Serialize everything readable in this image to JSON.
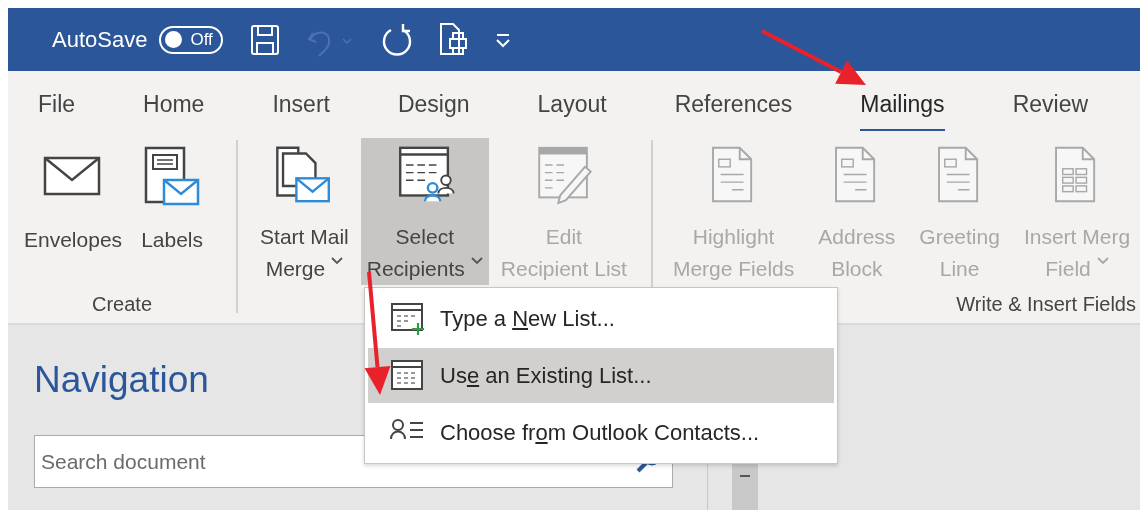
{
  "quick_access": {
    "autosave_label": "AutoSave",
    "autosave_toggle": {
      "on": false,
      "label": "Off"
    },
    "buttons": [
      {
        "kind": "save",
        "disabled": false
      },
      {
        "kind": "undo",
        "disabled": true
      },
      {
        "kind": "repeat",
        "disabled": false
      },
      {
        "kind": "print-preview",
        "disabled": false
      },
      {
        "kind": "customize",
        "disabled": false
      }
    ]
  },
  "tabs": [
    {
      "label": "File",
      "selected": false
    },
    {
      "label": "Home",
      "selected": false
    },
    {
      "label": "Insert",
      "selected": false
    },
    {
      "label": "Design",
      "selected": false
    },
    {
      "label": "Layout",
      "selected": false
    },
    {
      "label": "References",
      "selected": false
    },
    {
      "label": "Mailings",
      "selected": true
    },
    {
      "label": "Review",
      "selected": false
    }
  ],
  "ribbon_groups": [
    {
      "label": "Create",
      "buttons": [
        {
          "kind": "envelope",
          "lines": [
            "Envelopes"
          ],
          "dropdown": false,
          "disabled": false,
          "pressed": false
        },
        {
          "kind": "labels",
          "lines": [
            "Labels"
          ],
          "dropdown": false,
          "disabled": false,
          "pressed": false
        }
      ]
    },
    {
      "buttons": [
        {
          "kind": "start-merge",
          "lines": [
            "Start Mail",
            "Merge"
          ],
          "dropdown": true,
          "disabled": false,
          "pressed": false
        },
        {
          "kind": "select-recipients",
          "lines": [
            "Select",
            "Recipients"
          ],
          "dropdown": true,
          "disabled": false,
          "pressed": true
        },
        {
          "kind": "edit-list",
          "lines": [
            "Edit",
            "Recipient List"
          ],
          "dropdown": false,
          "disabled": true,
          "pressed": false
        }
      ]
    },
    {
      "label": "Write & Insert Fields",
      "buttons": [
        {
          "kind": "field-doc",
          "lines": [
            "Highlight",
            "Merge Fields"
          ],
          "dropdown": false,
          "disabled": true,
          "pressed": false
        },
        {
          "kind": "field-doc",
          "lines": [
            "Address",
            "Block"
          ],
          "dropdown": false,
          "disabled": true,
          "pressed": false
        },
        {
          "kind": "field-doc",
          "lines": [
            "Greeting",
            "Line"
          ],
          "dropdown": false,
          "disabled": true,
          "pressed": false
        },
        {
          "kind": "table-doc",
          "lines": [
            "Insert Merg",
            "Field"
          ],
          "dropdown": true,
          "disabled": true,
          "pressed": false
        }
      ]
    }
  ],
  "navigation": {
    "title": "Navigation",
    "search": {
      "placeholder": "Search document"
    }
  },
  "dropdown_menu": {
    "items": [
      {
        "kind": "new-list",
        "before": "Type a ",
        "access_key": "N",
        "after": "ew List...",
        "selected": false
      },
      {
        "kind": "existing-list",
        "before": "Us",
        "access_key": "e",
        "after": " an Existing List...",
        "selected": true
      },
      {
        "kind": "contacts",
        "before": "Choose fr",
        "access_key": "o",
        "after": "m Outlook Contacts...",
        "selected": false
      }
    ]
  },
  "annotations": [
    {
      "kind": "arrow"
    },
    {
      "kind": "arrow"
    }
  ]
}
